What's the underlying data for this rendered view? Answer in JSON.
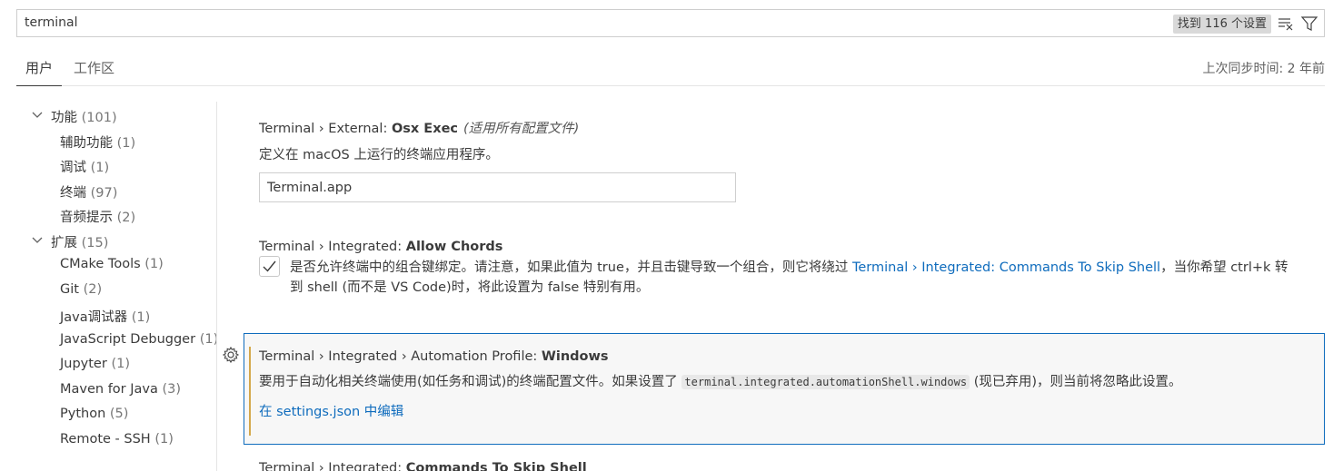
{
  "search": {
    "value": "terminal",
    "result_count": "找到 116 个设置"
  },
  "tabs": {
    "user": "用户",
    "workspace": "工作区",
    "sync_status": "上次同步时间: 2 年前"
  },
  "toc": {
    "groups": [
      {
        "label": "功能",
        "count": "(101)",
        "children": [
          {
            "label": "辅助功能",
            "count": "(1)"
          },
          {
            "label": "调试",
            "count": "(1)"
          },
          {
            "label": "终端",
            "count": "(97)"
          },
          {
            "label": "音频提示",
            "count": "(2)"
          }
        ]
      },
      {
        "label": "扩展",
        "count": "(15)",
        "children": [
          {
            "label": "CMake Tools",
            "count": "(1)"
          },
          {
            "label": "Git",
            "count": "(2)"
          },
          {
            "label": "Java调试器",
            "count": "(1)"
          },
          {
            "label": "JavaScript Debugger",
            "count": "(1)"
          },
          {
            "label": "Jupyter",
            "count": "(1)"
          },
          {
            "label": "Maven for Java",
            "count": "(3)"
          },
          {
            "label": "Python",
            "count": "(5)"
          },
          {
            "label": "Remote - SSH",
            "count": "(1)"
          }
        ]
      }
    ]
  },
  "settings": {
    "osx_exec": {
      "category": "Terminal › External: ",
      "key": "Osx Exec",
      "scope": "(适用所有配置文件)",
      "description": "定义在 macOS 上运行的终端应用程序。",
      "value": "Terminal.app"
    },
    "allow_chords": {
      "category": "Terminal › Integrated: ",
      "key": "Allow Chords",
      "checked": true,
      "desc_part1": "是否允许终端中的组合键绑定。请注意，如果此值为 true，并且击键导致一个组合，则它将绕过 ",
      "desc_link": "Terminal › Integrated: Commands To Skip Shell",
      "desc_part2": "，当你希望 ctrl+k 转到 shell (而不是 VS Code)时，将此设置为 false 特别有用。"
    },
    "automation_profile": {
      "category": "Terminal › Integrated › Automation Profile: ",
      "key": "Windows",
      "desc_part1": "要用于自动化相关终端使用(如任务和调试)的终端配置文件。如果设置了 ",
      "desc_code": "terminal.integrated.automationShell.windows",
      "desc_part2": " (现已弃用)，则当前将忽略此设置。",
      "edit_link": "在 settings.json 中编辑"
    },
    "commands_to_skip": {
      "category": "Terminal › Integrated: ",
      "key": "Commands To Skip Shell"
    }
  }
}
